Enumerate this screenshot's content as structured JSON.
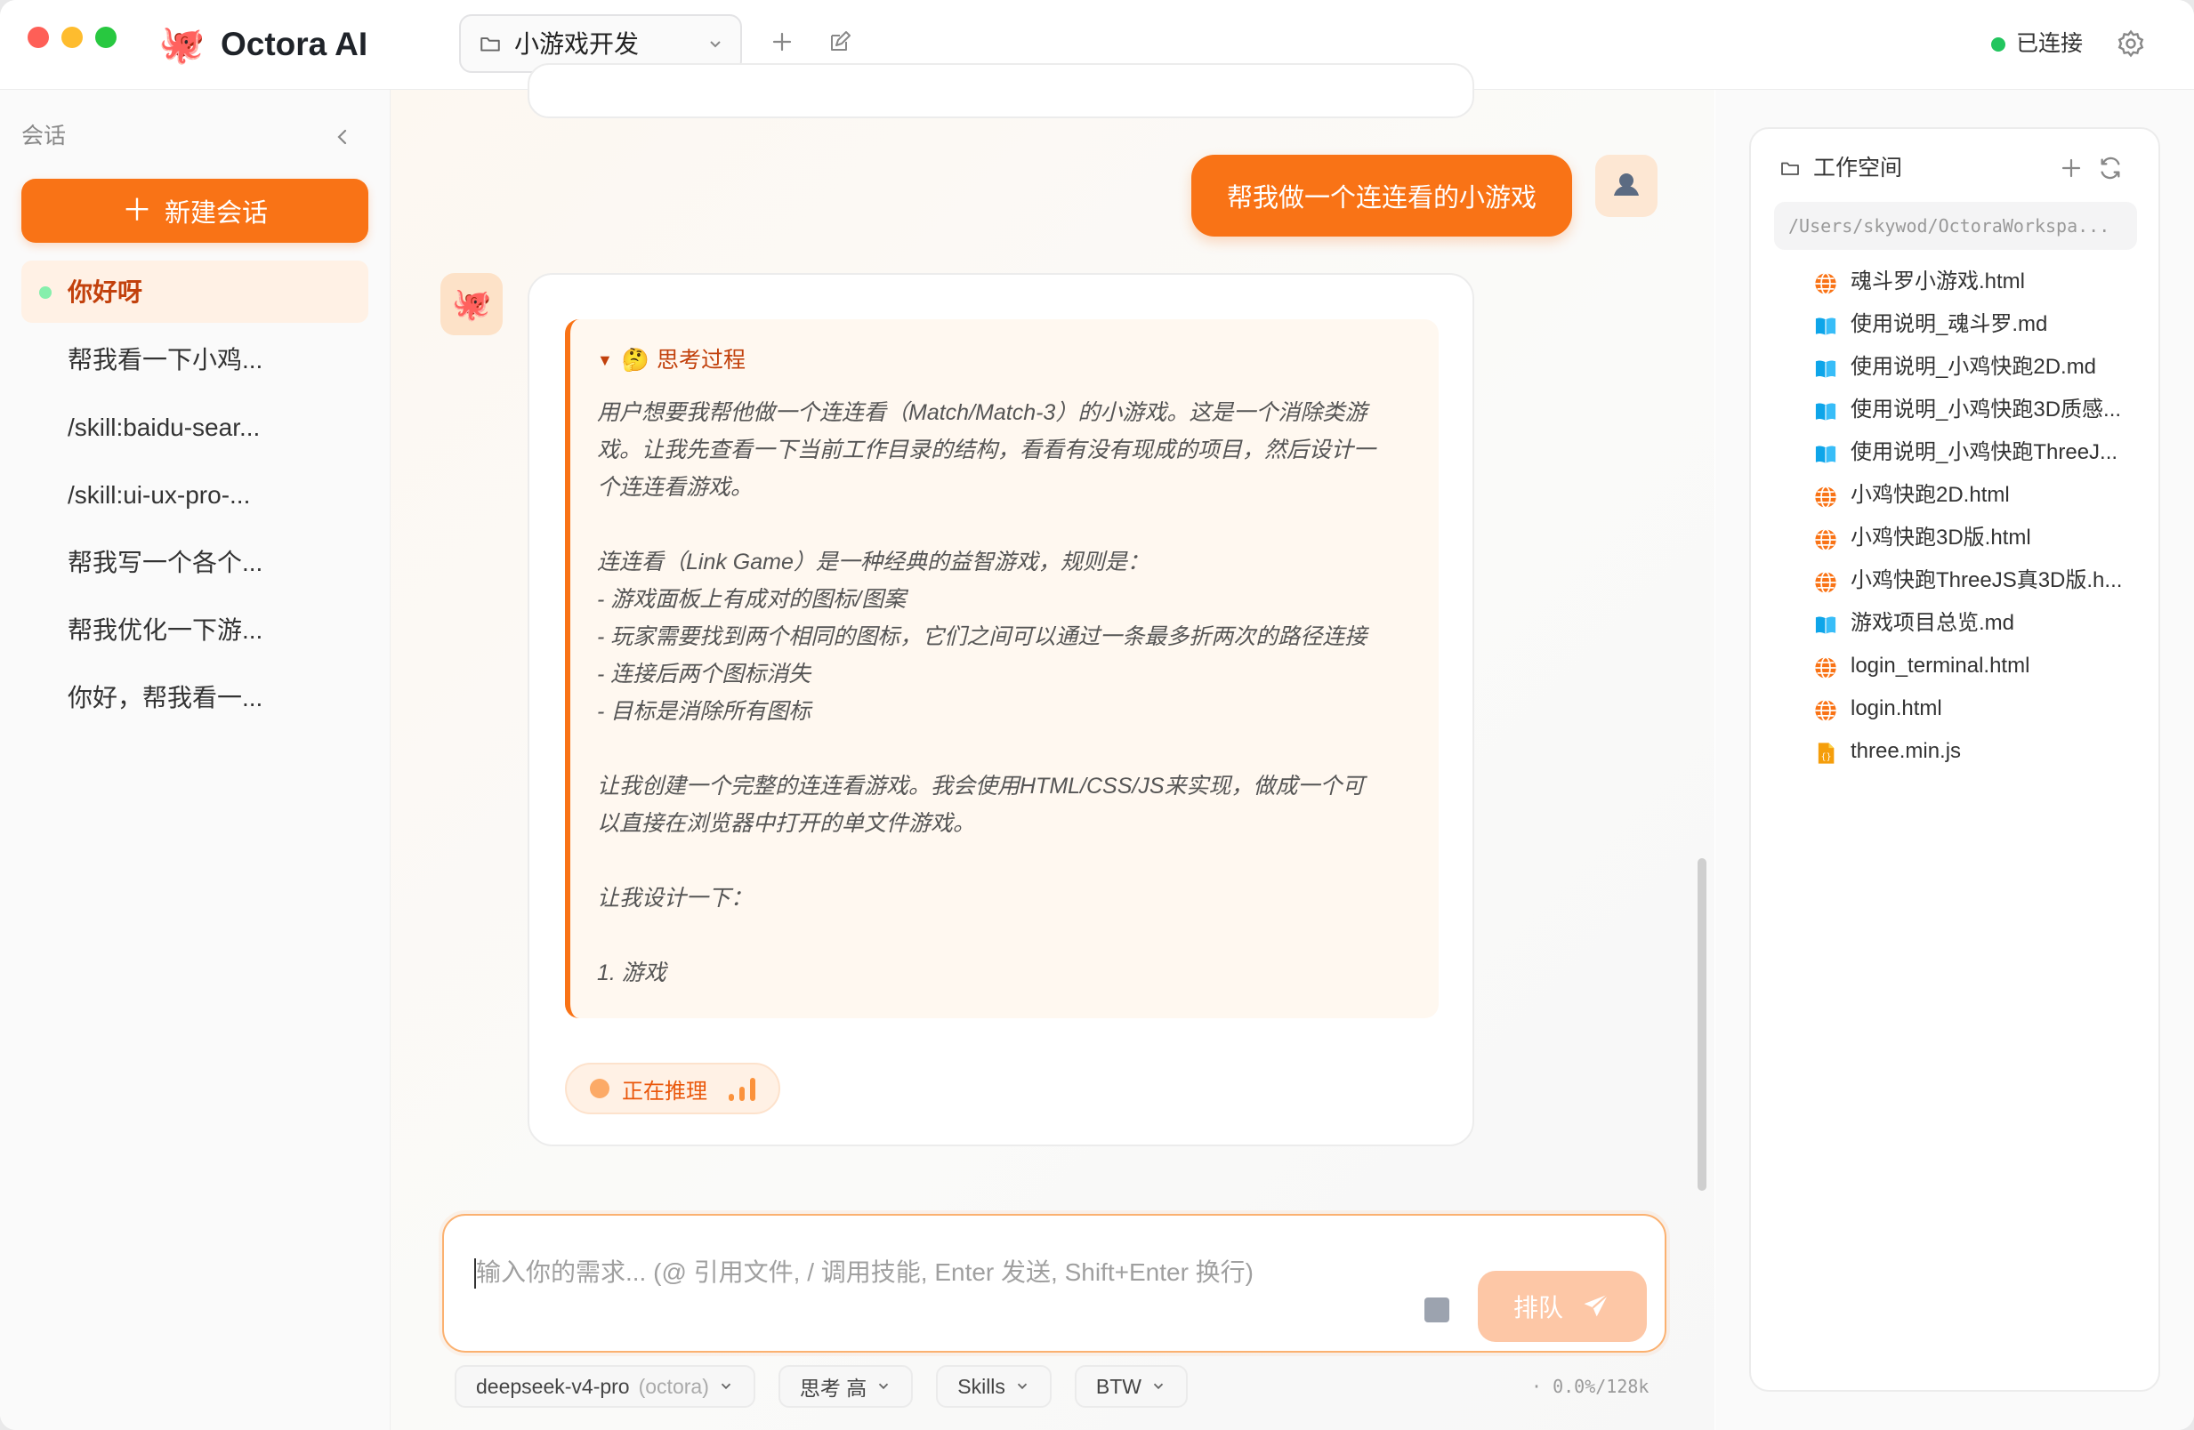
{
  "window": {
    "traffic_lights": [
      "close",
      "minimize",
      "zoom"
    ]
  },
  "header": {
    "app_title": "Octora AI",
    "logo_icon": "octopus-icon",
    "project": "小游戏开发",
    "status": "已连接",
    "status_color": "#22c55e",
    "accent_color": "#f97316"
  },
  "sidebar": {
    "title": "会话",
    "new_chat": "新建会话",
    "items": [
      {
        "label": "你好呀",
        "active": true
      },
      {
        "label": "帮我看一下小鸡..."
      },
      {
        "label": "/skill:baidu-sear..."
      },
      {
        "label": "/skill:ui-ux-pro-..."
      },
      {
        "label": "帮我写一个各个..."
      },
      {
        "label": "帮我优化一下游..."
      },
      {
        "label": "你好，帮我看一..."
      }
    ]
  },
  "chat": {
    "user_message": "帮我做一个连连看的小游戏",
    "thinking": {
      "emoji": "🤔",
      "title": "思考过程",
      "lines": [
        "用户想要我帮他做一个连连看（Match/Match-3）的小游戏。这是一个消除类游",
        "戏。让我先查看一下当前工作目录的结构，看看有没有现成的项目，然后设计一",
        "个连连看游戏。",
        "",
        "连连看（Link Game）是一种经典的益智游戏，规则是：",
        "- 游戏面板上有成对的图标/图案",
        "- 玩家需要找到两个相同的图标，它们之间可以通过一条最多折两次的路径连接",
        "- 连接后两个图标消失",
        "- 目标是消除所有图标",
        "",
        "让我创建一个完整的连连看游戏。我会使用HTML/CSS/JS来实现，做成一个可",
        "以直接在浏览器中打开的单文件游戏。",
        "",
        "让我设计一下：",
        "",
        "1. 游戏"
      ]
    },
    "reasoning_status": "正在推理",
    "composer_placeholder": "输入你的需求... (@ 引用文件, / 调用技能, Enter 发送, Shift+Enter 换行)",
    "send_label": "排队",
    "model": "deepseek-v4-pro",
    "model_provider": "(octora)",
    "thinking_level": "思考 高",
    "skills": "Skills",
    "btw": "BTW",
    "context_usage": "· 0.0%/128k"
  },
  "workspace": {
    "title": "工作空间",
    "path": "/Users/skywod/OctoraWorkspa...",
    "files": [
      {
        "name": "魂斗罗小游戏.html",
        "icon": "globe-icon"
      },
      {
        "name": "使用说明_魂斗罗.md",
        "icon": "book-icon"
      },
      {
        "name": "使用说明_小鸡快跑2D.md",
        "icon": "book-icon"
      },
      {
        "name": "使用说明_小鸡快跑3D质感...",
        "icon": "book-icon"
      },
      {
        "name": "使用说明_小鸡快跑ThreeJ...",
        "icon": "book-icon"
      },
      {
        "name": "小鸡快跑2D.html",
        "icon": "globe-icon"
      },
      {
        "name": "小鸡快跑3D版.html",
        "icon": "globe-icon"
      },
      {
        "name": "小鸡快跑ThreeJS真3D版.h...",
        "icon": "globe-icon"
      },
      {
        "name": "游戏项目总览.md",
        "icon": "book-icon"
      },
      {
        "name": "login_terminal.html",
        "icon": "globe-icon"
      },
      {
        "name": "login.html",
        "icon": "globe-icon"
      },
      {
        "name": "three.min.js",
        "icon": "js-file-icon"
      }
    ]
  }
}
